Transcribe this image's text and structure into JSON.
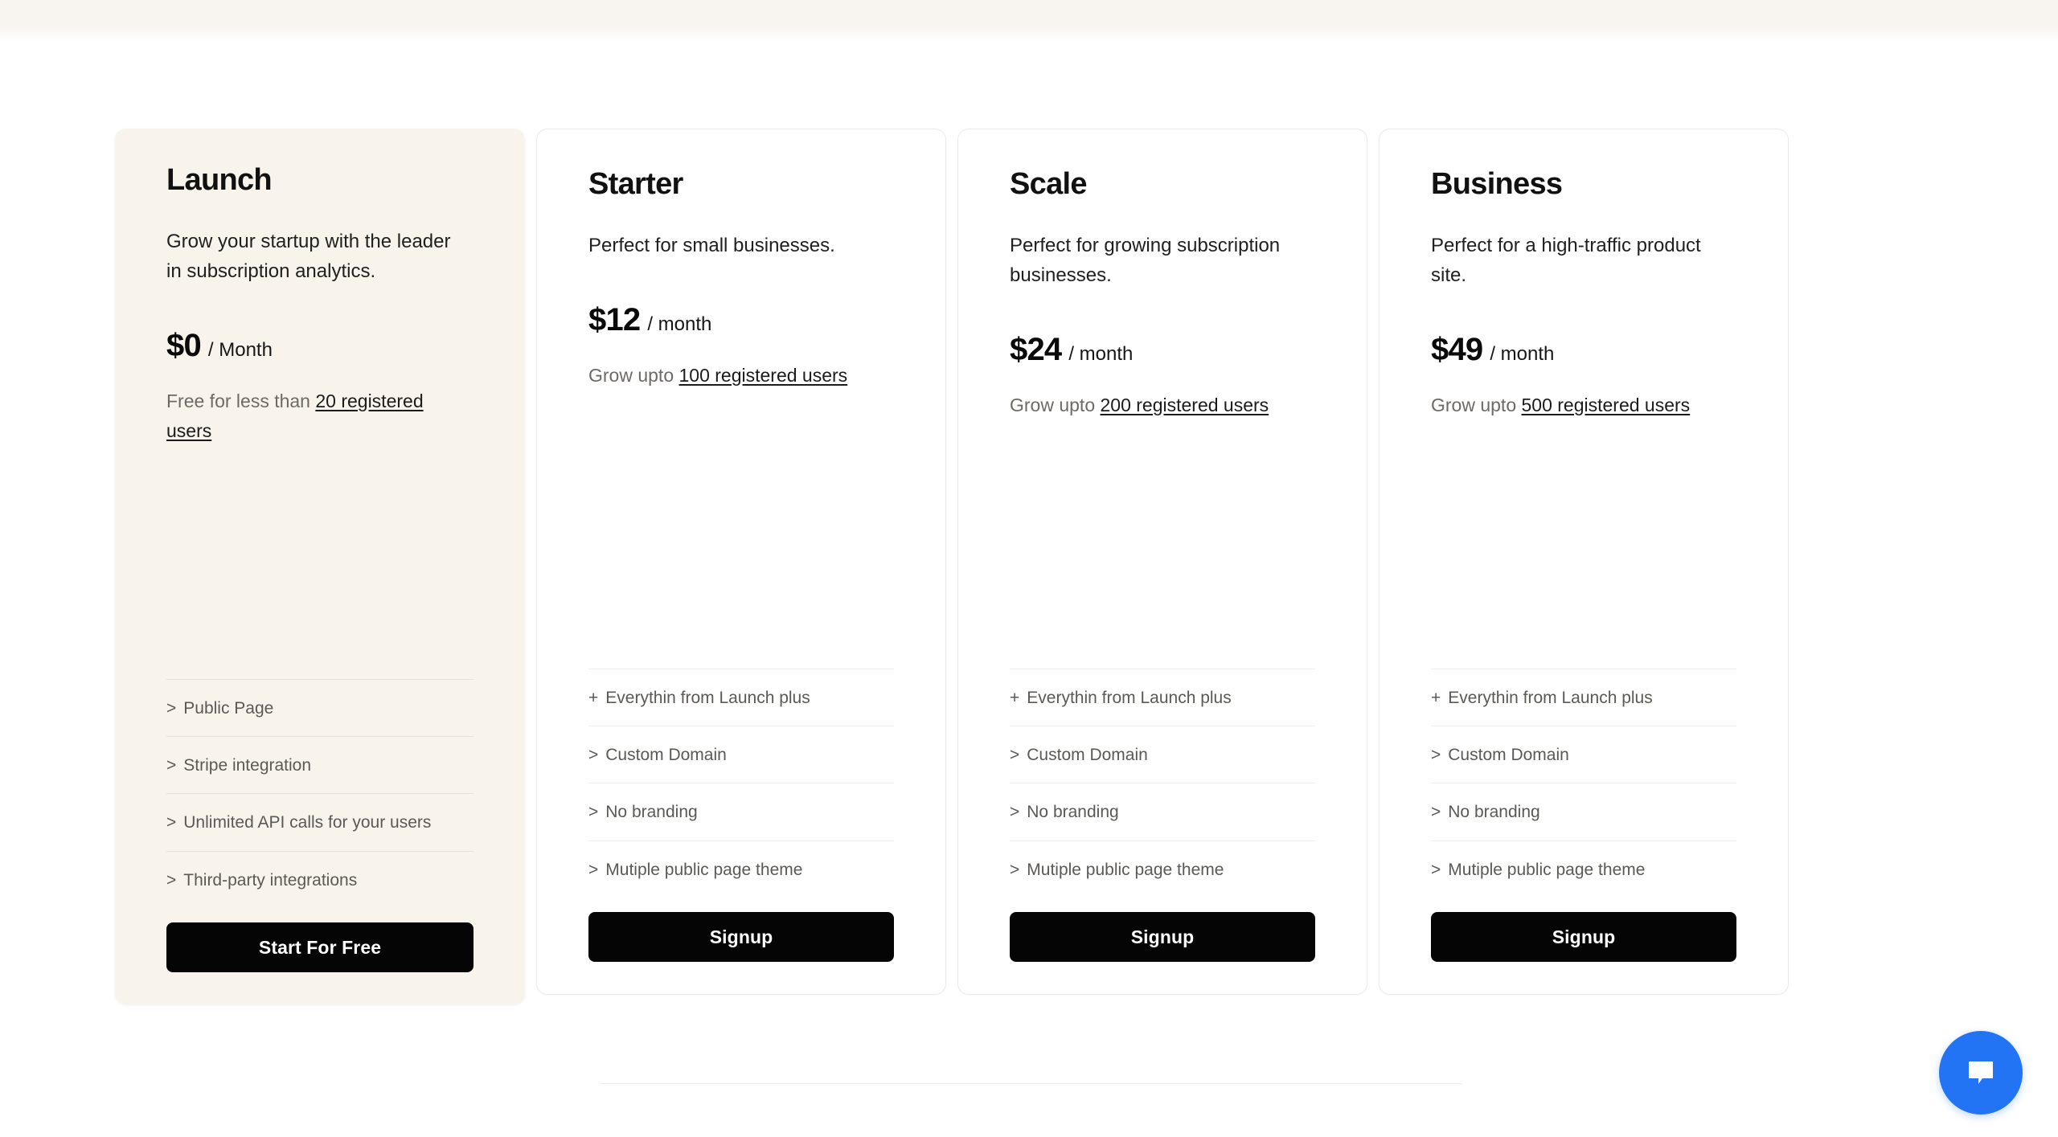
{
  "theme": {
    "accent_black": "#050505",
    "featured_card_bg": "#f8f4ec",
    "chat_blue": "#2274f5",
    "muted_text": "#6d6a66"
  },
  "pricing": {
    "plans": [
      {
        "name": "Launch",
        "tagline": "Grow your startup with the leader in subscription analytics.",
        "price": "$0",
        "period": "/ Month",
        "limit_prefix": "Free for less than ",
        "limit_link": "20 registered users",
        "features": [
          {
            "marker": ">",
            "label": "Public Page"
          },
          {
            "marker": ">",
            "label": "Stripe integration"
          },
          {
            "marker": ">",
            "label": "Unlimited API calls for your users"
          },
          {
            "marker": ">",
            "label": "Third-party integrations"
          }
        ],
        "cta_label": "Start For Free"
      },
      {
        "name": "Starter",
        "tagline": "Perfect for small businesses.",
        "price": "$12",
        "period": "/ month",
        "limit_prefix": "Grow upto ",
        "limit_link": "100 registered users",
        "features": [
          {
            "marker": "+",
            "label": "Everythin from Launch plus"
          },
          {
            "marker": ">",
            "label": "Custom Domain"
          },
          {
            "marker": ">",
            "label": "No branding"
          },
          {
            "marker": ">",
            "label": "Mutiple public page theme"
          }
        ],
        "cta_label": "Signup"
      },
      {
        "name": "Scale",
        "tagline": "Perfect for growing subscription businesses.",
        "price": "$24",
        "period": "/ month",
        "limit_prefix": "Grow upto ",
        "limit_link": "200 registered users",
        "features": [
          {
            "marker": "+",
            "label": "Everythin from Launch plus"
          },
          {
            "marker": ">",
            "label": "Custom Domain"
          },
          {
            "marker": ">",
            "label": "No branding"
          },
          {
            "marker": ">",
            "label": "Mutiple public page theme"
          }
        ],
        "cta_label": "Signup"
      },
      {
        "name": "Business",
        "tagline": "Perfect for a high-traffic product site.",
        "price": "$49",
        "period": "/ month",
        "limit_prefix": "Grow upto ",
        "limit_link": "500 registered users",
        "features": [
          {
            "marker": "+",
            "label": "Everythin from Launch plus"
          },
          {
            "marker": ">",
            "label": "Custom Domain"
          },
          {
            "marker": ">",
            "label": "No branding"
          },
          {
            "marker": ">",
            "label": "Mutiple public page theme"
          }
        ],
        "cta_label": "Signup"
      }
    ]
  },
  "chat_widget": {
    "icon": "chat-bubble-icon"
  }
}
